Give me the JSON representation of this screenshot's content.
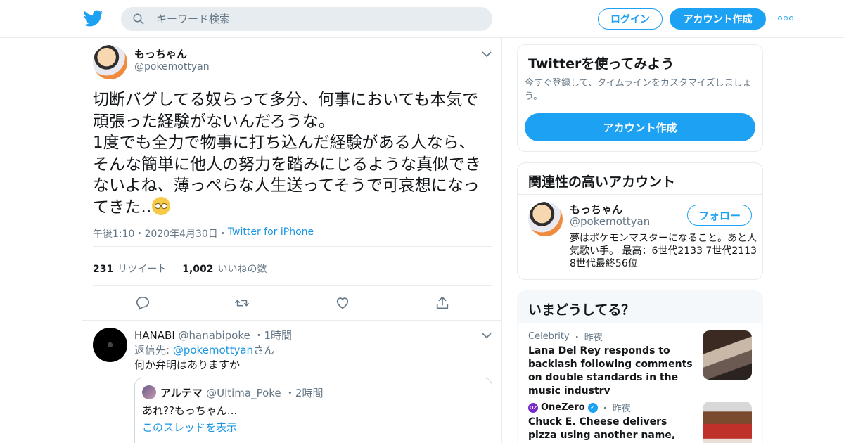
{
  "header": {
    "search_placeholder": "キーワード検索",
    "login_label": "ログイン",
    "signup_label": "アカウント作成"
  },
  "tweet": {
    "name": "もっちゃん",
    "handle": "@pokemottyan",
    "text": "切断バグしてる奴らって多分、何事においても本気で\n頑張った経験がないんだろうな。\n1度でも全力で物事に打ち込んだ経験がある人なら、\nそんな簡単に他人の努力を踏みにじるような真似でき\nないよね、薄っぺらな人生送ってそうで可哀想になっ\nてきた‥",
    "time": "午後1:10",
    "date": "2020年4月30日",
    "source": "Twitter for iPhone",
    "separator": "・",
    "retweets_count": "231",
    "retweets_label": "リツイート",
    "likes_count": "1,002",
    "likes_label": "いいねの数"
  },
  "reply": {
    "name": "HANABI",
    "handle": "@hanabipoke",
    "time": "1時間",
    "replying_prefix": "返信先:",
    "replying_to": "@pokemottyan",
    "replying_suffix": "さん",
    "text": "何か弁明はありますか",
    "quote": {
      "name": "アルテマ",
      "handle": "@Ultima_Poke",
      "time": "2時間",
      "text": "あれ??もっちゃん...",
      "link": "このスレッドを表示"
    }
  },
  "sidebar": {
    "signup_card": {
      "title": "Twitterを使ってみよう",
      "desc": "今すぐ登録して、タイムラインをカスタマイズしましょう。",
      "button": "アカウント作成"
    },
    "related": {
      "title": "関連性の高いアカウント",
      "name": "もっちゃん",
      "handle": "@pokemottyan",
      "follow": "フォロー",
      "bio": "夢はポケモンマスターになること。あと人気歌い手。 最高：6世代2133 7世代2113 8世代最終56位"
    },
    "trends": {
      "title": "いまどうしてる？",
      "items": [
        {
          "category": "Celebrity",
          "time": "昨夜",
          "title": "Lana Del Rey responds to backlash following comments on double standards in the music industry"
        },
        {
          "category": "OneZero",
          "badge": "OZ",
          "time": "昨夜",
          "title": "Chuck E. Cheese delivers pizza using another name, and it's not"
        }
      ]
    }
  },
  "colors": {
    "accent": "#1da1f2",
    "link": "#1b95e0",
    "muted": "#657786",
    "border": "#e6ecf0"
  },
  "icons": [
    "twitter-bird-icon",
    "search-icon",
    "more-icon",
    "chevron-down-icon",
    "reply-icon",
    "retweet-icon",
    "like-icon",
    "share-icon",
    "verified-icon"
  ]
}
